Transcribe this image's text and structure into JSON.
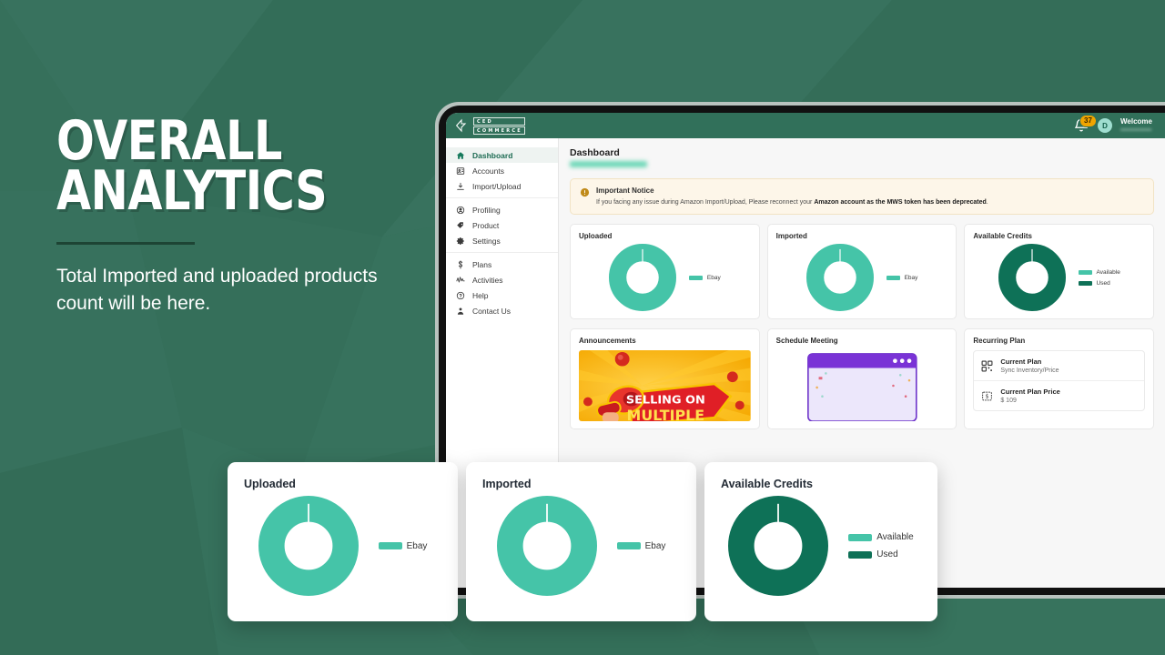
{
  "promo": {
    "title_line1": "OVERALL",
    "title_line2": "ANALYTICS",
    "subtitle": "Total Imported and uploaded products count will be here."
  },
  "colors": {
    "background": "#36705b",
    "brand_green": "#31705a",
    "teal": "#45c4a8",
    "dark_green": "#0e7157",
    "badge_amber": "#f0a500",
    "notice_bg": "#fdf6e9"
  },
  "app": {
    "logo": {
      "icon": "cedcommerce-logo-icon",
      "line1": "CED",
      "line2": "COMMERCE"
    },
    "header": {
      "notification_icon": "bell-icon",
      "notification_count": "37",
      "avatar_initial": "D",
      "welcome_label": "Welcome",
      "welcome_user": "••••••••••••••"
    },
    "sidebar": {
      "groups": [
        {
          "items": [
            {
              "label": "Dashboard",
              "icon": "home-icon",
              "active": true
            },
            {
              "label": "Accounts",
              "icon": "id-card-icon",
              "active": false
            },
            {
              "label": "Import/Upload",
              "icon": "download-icon",
              "active": false
            }
          ]
        },
        {
          "items": [
            {
              "label": "Profiling",
              "icon": "user-circle-icon",
              "active": false
            },
            {
              "label": "Product",
              "icon": "tag-icon",
              "active": false
            },
            {
              "label": "Settings",
              "icon": "gear-icon",
              "active": false
            }
          ]
        },
        {
          "items": [
            {
              "label": "Plans",
              "icon": "dollar-icon",
              "active": false
            },
            {
              "label": "Activities",
              "icon": "activity-icon",
              "active": false
            },
            {
              "label": "Help",
              "icon": "question-circle-icon",
              "active": false
            },
            {
              "label": "Contact Us",
              "icon": "person-icon",
              "active": false
            }
          ]
        }
      ]
    },
    "main": {
      "page_title": "Dashboard",
      "page_subtitle": "",
      "notice": {
        "icon": "warning-icon",
        "title": "Important Notice",
        "body_plain": "If you facing any issue during Amazon Import/Upload, Please reconnect your ",
        "body_bold": "Amazon account as the MWS token has been deprecated",
        "body_tail": "."
      },
      "cards_row1": [
        {
          "title": "Uploaded"
        },
        {
          "title": "Imported"
        },
        {
          "title": "Available Credits"
        }
      ],
      "cards_row2": [
        {
          "title": "Announcements",
          "banner_text_1": "SELLING ON",
          "banner_text_2": "MULTIPLE"
        },
        {
          "title": "Schedule Meeting"
        },
        {
          "title": "Recurring Plan"
        }
      ],
      "recurring_plan": {
        "items": [
          {
            "icon": "qr-code-icon",
            "label": "Current Plan",
            "value": "Sync Inventory/Price"
          },
          {
            "icon": "price-tag-icon",
            "label": "Current Plan Price",
            "value": "$ 109"
          }
        ]
      }
    }
  },
  "overlay_cards": [
    {
      "title": "Uploaded"
    },
    {
      "title": "Imported"
    },
    {
      "title": "Available Credits"
    }
  ],
  "chart_data": [
    {
      "type": "pie",
      "title": "Uploaded",
      "labels": [
        "Ebay"
      ],
      "values": [
        100
      ],
      "colors": [
        "#45c4a8"
      ],
      "legend_position": "right",
      "donut": true
    },
    {
      "type": "pie",
      "title": "Imported",
      "labels": [
        "Ebay"
      ],
      "values": [
        100
      ],
      "colors": [
        "#45c4a8"
      ],
      "legend_position": "right",
      "donut": true
    },
    {
      "type": "pie",
      "title": "Available Credits",
      "labels": [
        "Available",
        "Used"
      ],
      "values": [
        0,
        100
      ],
      "colors": [
        "#45c4a8",
        "#0e7157"
      ],
      "legend_position": "right",
      "donut": true
    }
  ]
}
